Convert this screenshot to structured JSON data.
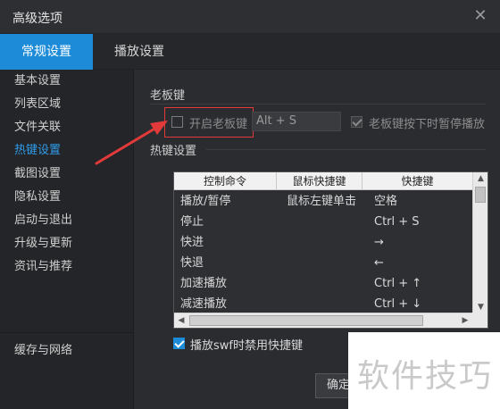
{
  "window": {
    "title": "高级选项",
    "close_glyph": "✕"
  },
  "tabs": [
    {
      "label": "常规设置",
      "active": true
    },
    {
      "label": "播放设置",
      "active": false
    }
  ],
  "sidebar": {
    "items": [
      {
        "label": "基本设置",
        "active": false
      },
      {
        "label": "列表区域",
        "active": false
      },
      {
        "label": "文件关联",
        "active": false
      },
      {
        "label": "热键设置",
        "active": true
      },
      {
        "label": "截图设置",
        "active": false
      },
      {
        "label": "隐私设置",
        "active": false
      },
      {
        "label": "启动与退出",
        "active": false
      },
      {
        "label": "升级与更新",
        "active": false
      },
      {
        "label": "资讯与推荐",
        "active": false
      }
    ],
    "bottom_item": {
      "label": "缓存与网络"
    }
  },
  "boss_key": {
    "section_label": "老板键",
    "enable_label": "开启老板键",
    "enable_checked": false,
    "hotkey_value": "Alt + S",
    "pause_label": "老板键按下时暂停播放",
    "pause_checked": true
  },
  "hotkeys": {
    "section_label": "热键设置",
    "columns": [
      "控制命令",
      "鼠标快捷键",
      "快捷键"
    ],
    "rows": [
      {
        "command": "播放/暂停",
        "mouse": "鼠标左键单击",
        "key": "空格"
      },
      {
        "command": "停止",
        "mouse": "",
        "key": "Ctrl + S"
      },
      {
        "command": "快进",
        "mouse": "",
        "key": "→"
      },
      {
        "command": "快退",
        "mouse": "",
        "key": "←"
      },
      {
        "command": "加速播放",
        "mouse": "",
        "key": "Ctrl + ↑"
      },
      {
        "command": "减速播放",
        "mouse": "",
        "key": "Ctrl + ↓"
      }
    ],
    "swf_label": "播放swf时禁用快捷键",
    "swf_checked": true
  },
  "footer": {
    "ok_label": "确定"
  },
  "watermark": {
    "text": "软件技巧"
  },
  "colors": {
    "accent": "#1d8bd8",
    "annotation_red": "#e23a3a",
    "active_sidebar": "#2f9cea"
  }
}
